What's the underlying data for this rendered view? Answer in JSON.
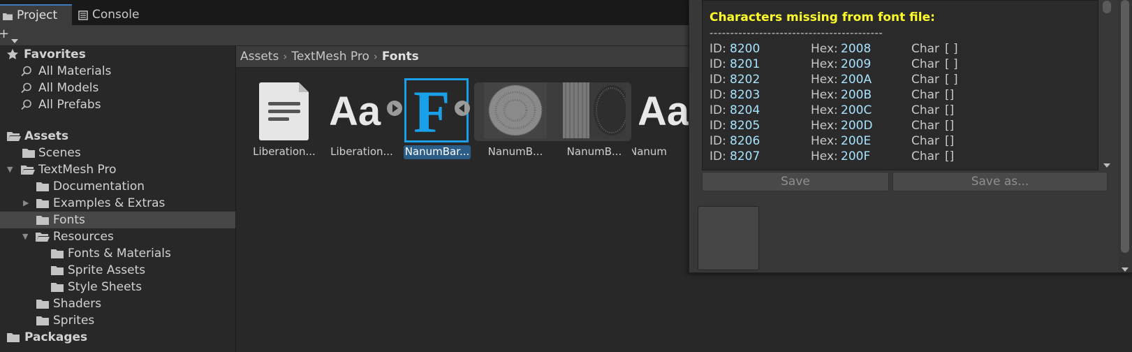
{
  "tabs": [
    {
      "label": "Project",
      "icon": "folder-icon"
    },
    {
      "label": "Console",
      "icon": "console-icon"
    }
  ],
  "toolbar": {
    "add_label": "+",
    "add_icon": "plus-icon",
    "dropdown_icon": "chevron-down-icon"
  },
  "tree": {
    "favorites": {
      "label": "Favorites",
      "items": [
        "All Materials",
        "All Models",
        "All Prefabs"
      ]
    },
    "assets_label": "Assets",
    "scenes": "Scenes",
    "textmesh": "TextMesh Pro",
    "documentation": "Documentation",
    "examples": "Examples & Extras",
    "fonts": "Fonts",
    "resources": "Resources",
    "fonts_materials": "Fonts & Materials",
    "sprite_assets": "Sprite Assets",
    "style_sheets": "Style Sheets",
    "shaders": "Shaders",
    "sprites": "Sprites",
    "packages": "Packages"
  },
  "breadcrumb": [
    "Assets",
    "TextMesh Pro",
    "Fonts"
  ],
  "assets": [
    {
      "name": "Liberation...",
      "kind": "document-icon"
    },
    {
      "name": "Liberation...",
      "kind": "font-aa-icon"
    },
    {
      "name": "NanumBar...",
      "kind": "font-f-icon",
      "selected": true
    },
    {
      "name": "NanumB...",
      "kind": "atlas-texture"
    },
    {
      "name": "NanumB...",
      "kind": "atlas-texture"
    },
    {
      "name": "Nanum",
      "kind": "font-aa-icon"
    }
  ],
  "report": {
    "heading": "Characters missing from font file:",
    "dashes": "------------------------------------------",
    "id_label": "ID:",
    "hex_label": "Hex:",
    "char_label": "Char",
    "rows": [
      {
        "id": "8200",
        "hex": "2008",
        "char": "[ ]"
      },
      {
        "id": "8201",
        "hex": "2009",
        "char": "[ ]"
      },
      {
        "id": "8202",
        "hex": "200A",
        "char": "[ ]"
      },
      {
        "id": "8203",
        "hex": "200B",
        "char": "[]"
      },
      {
        "id": "8204",
        "hex": "200C",
        "char": "[]"
      },
      {
        "id": "8205",
        "hex": "200D",
        "char": "[]"
      },
      {
        "id": "8206",
        "hex": "200E",
        "char": "[]"
      },
      {
        "id": "8207",
        "hex": "200F",
        "char": "[]"
      }
    ]
  },
  "buttons": {
    "save": "Save",
    "save_as": "Save as..."
  },
  "colors": {
    "selection": "#2c5d87",
    "heading_yellow": "#ffff2a",
    "value_cyan": "#a7e3ff",
    "font_blue": "#1aa0e8"
  }
}
